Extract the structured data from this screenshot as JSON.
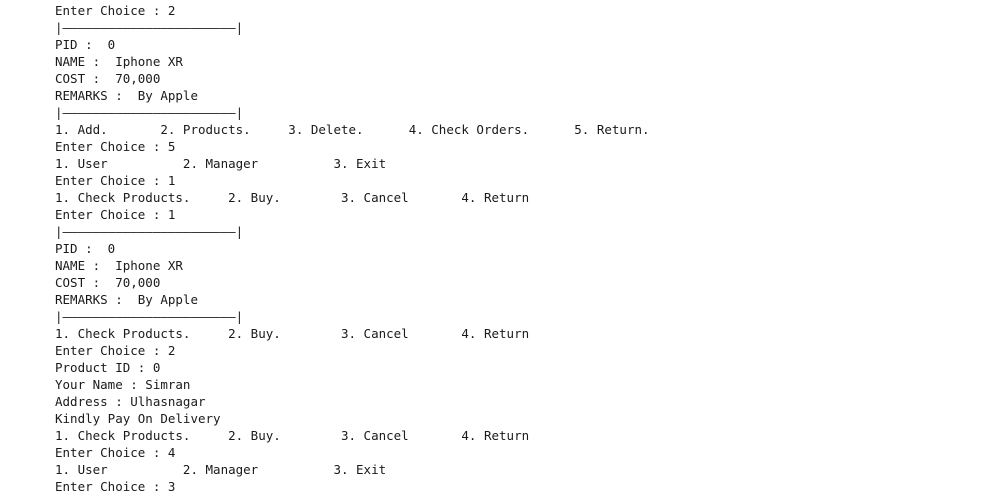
{
  "console": {
    "lines": [
      "Enter Choice : 2",
      "|———————————————————————|",
      "PID :  0",
      "NAME :  Iphone XR",
      "COST :  70,000",
      "REMARKS :  By Apple",
      "|———————————————————————|",
      "1. Add.       2. Products.     3. Delete.      4. Check Orders.      5. Return.",
      "Enter Choice : 5",
      "1. User          2. Manager          3. Exit",
      "Enter Choice : 1",
      "1. Check Products.     2. Buy.        3. Cancel       4. Return",
      "Enter Choice : 1",
      "|———————————————————————|",
      "PID :  0",
      "NAME :  Iphone XR",
      "COST :  70,000",
      "REMARKS :  By Apple",
      "|———————————————————————|",
      "1. Check Products.     2. Buy.        3. Cancel       4. Return",
      "Enter Choice : 2",
      "Product ID : 0",
      "Your Name : Simran",
      "Address : Ulhasnagar",
      "Kindly Pay On Delivery",
      "1. Check Products.     2. Buy.        3. Cancel       4. Return",
      "Enter Choice : 4",
      "1. User          2. Manager          3. Exit",
      "Enter Choice : 3"
    ]
  }
}
